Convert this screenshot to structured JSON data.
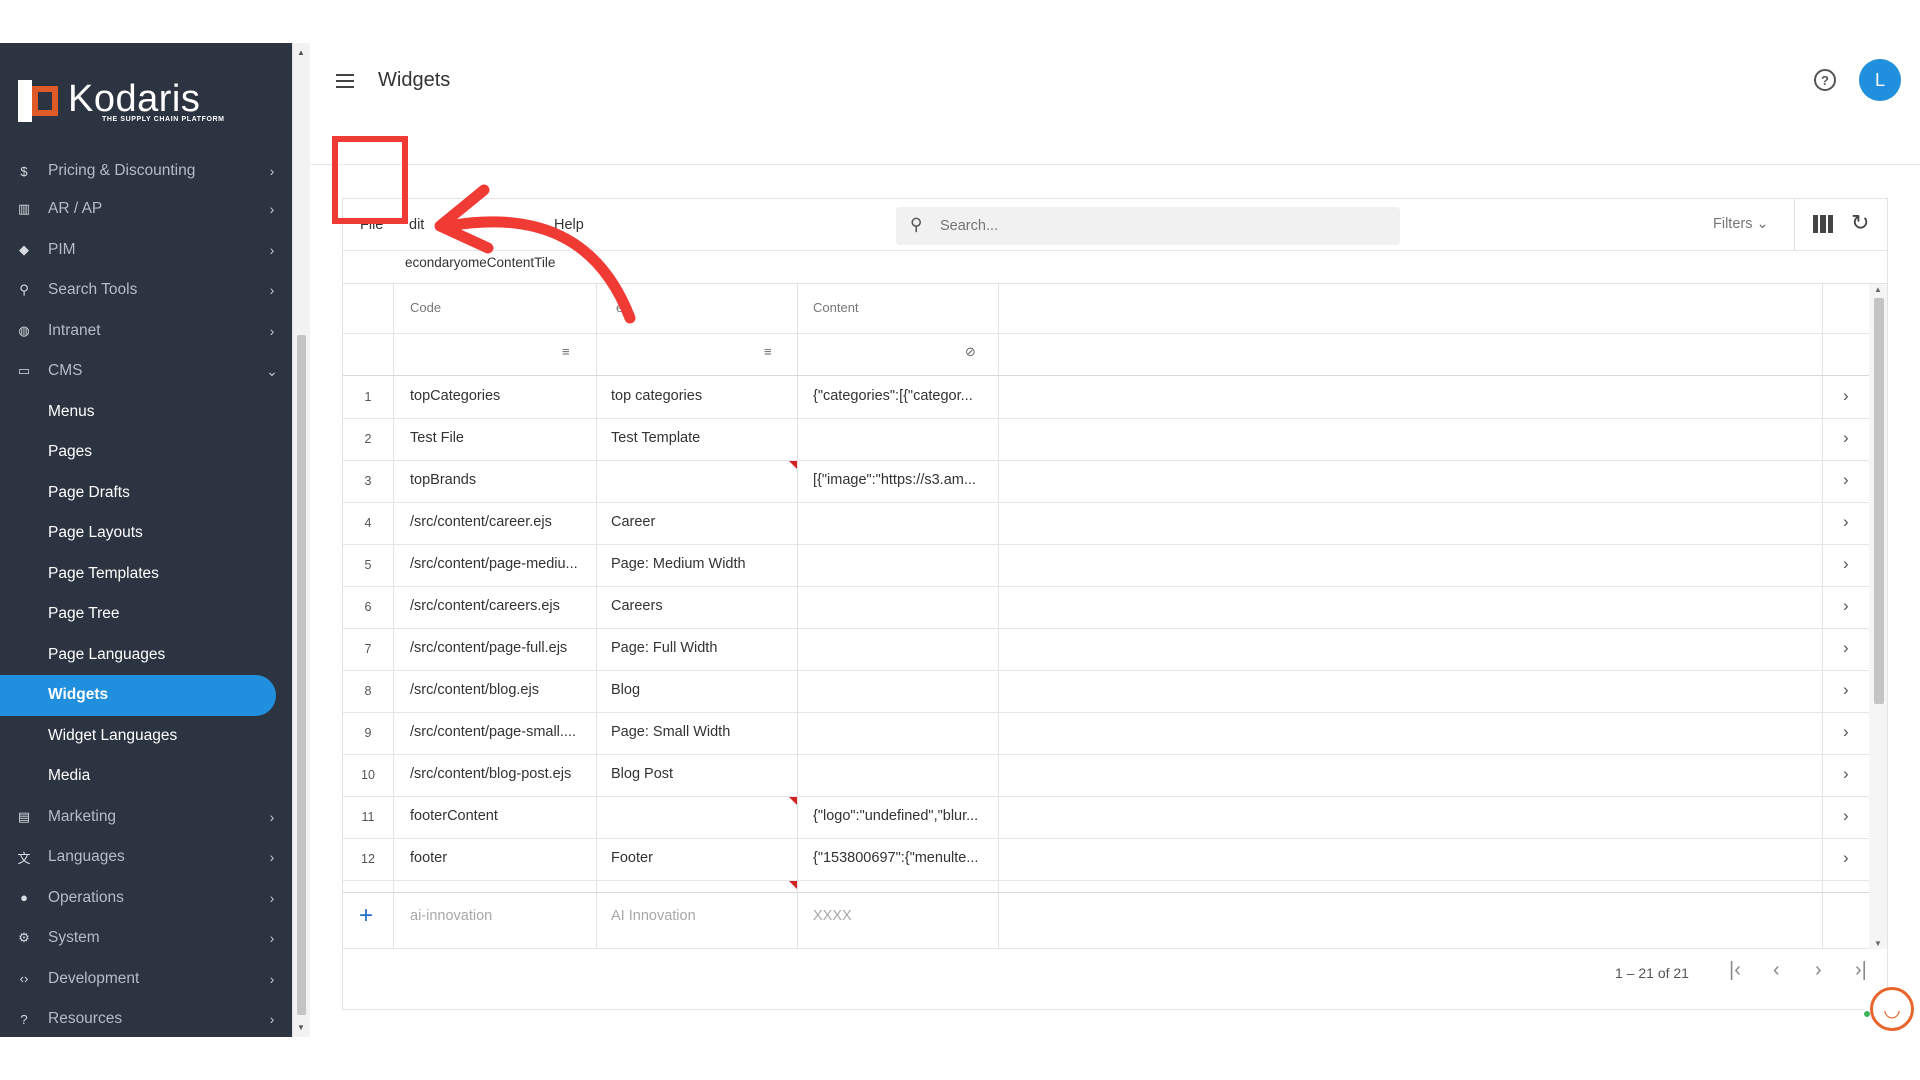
{
  "brand": {
    "name": "Kodaris",
    "tagline": "THE SUPPLY CHAIN PLATFORM"
  },
  "sidebar": {
    "items": [
      {
        "label": "Pricing & Discounting",
        "icon": "dollar-icon"
      },
      {
        "label": "AR / AP",
        "icon": "bank-icon"
      },
      {
        "label": "PIM",
        "icon": "tag-icon"
      },
      {
        "label": "Search Tools",
        "icon": "search-icon"
      },
      {
        "label": "Intranet",
        "icon": "globe-icon"
      },
      {
        "label": "CMS",
        "icon": "window-icon"
      }
    ],
    "cms_children": [
      "Menus",
      "Pages",
      "Page Drafts",
      "Page Layouts",
      "Page Templates",
      "Page Tree",
      "Page Languages",
      "Widgets",
      "Widget Languages",
      "Media"
    ],
    "items_after": [
      {
        "label": "Marketing",
        "icon": "megaphone-icon"
      },
      {
        "label": "Languages",
        "icon": "translate-icon"
      },
      {
        "label": "Operations",
        "icon": "palette-icon"
      },
      {
        "label": "System",
        "icon": "gear-icon"
      },
      {
        "label": "Development",
        "icon": "code-icon"
      },
      {
        "label": "Resources",
        "icon": "help-circle-icon"
      }
    ]
  },
  "header": {
    "title": "Widgets",
    "avatar_initial": "L"
  },
  "toolbar": {
    "file_label": "File",
    "edit_label": "dit",
    "help_label": "Help",
    "search_placeholder": "Search...",
    "filters_label": "Filters"
  },
  "subtitle": "econdary‌omeContentTile",
  "table": {
    "columns": [
      "Code",
      "e",
      "Content"
    ],
    "rows": [
      {
        "n": "1",
        "code": "topCategories",
        "name": "top categories",
        "content": "{\"categories\":[{\"categor..."
      },
      {
        "n": "2",
        "code": "Test File",
        "name": "Test Template",
        "content": ""
      },
      {
        "n": "3",
        "code": "topBrands",
        "name": "",
        "content": "[{\"image\":\"https://s3.am..."
      },
      {
        "n": "4",
        "code": "/src/content/career.ejs",
        "name": "Career",
        "content": ""
      },
      {
        "n": "5",
        "code": "/src/content/page-mediu...",
        "name": "Page: Medium Width",
        "content": ""
      },
      {
        "n": "6",
        "code": "/src/content/careers.ejs",
        "name": "Careers",
        "content": ""
      },
      {
        "n": "7",
        "code": "/src/content/page-full.ejs",
        "name": "Page: Full Width",
        "content": ""
      },
      {
        "n": "8",
        "code": "/src/content/blog.ejs",
        "name": "Blog",
        "content": ""
      },
      {
        "n": "9",
        "code": "/src/content/page-small....",
        "name": "Page: Small Width",
        "content": ""
      },
      {
        "n": "10",
        "code": "/src/content/blog-post.ejs",
        "name": "Blog Post",
        "content": ""
      },
      {
        "n": "11",
        "code": "footerContent",
        "name": "",
        "content": "{\"logo\":\"undefined\",\"blur..."
      },
      {
        "n": "12",
        "code": "footer",
        "name": "Footer",
        "content": "{\"153800697\":{\"menulte..."
      }
    ],
    "new_row": {
      "code": "ai-innovation",
      "name": "AI Innovation",
      "content": "XXXX"
    }
  },
  "pager": {
    "info": "1 – 21 of 21"
  },
  "colors": {
    "accent": "#1f8fde",
    "sidebar_bg": "#2b3440",
    "annotation": "#ef3b33",
    "brand_orange": "#e05a28"
  }
}
